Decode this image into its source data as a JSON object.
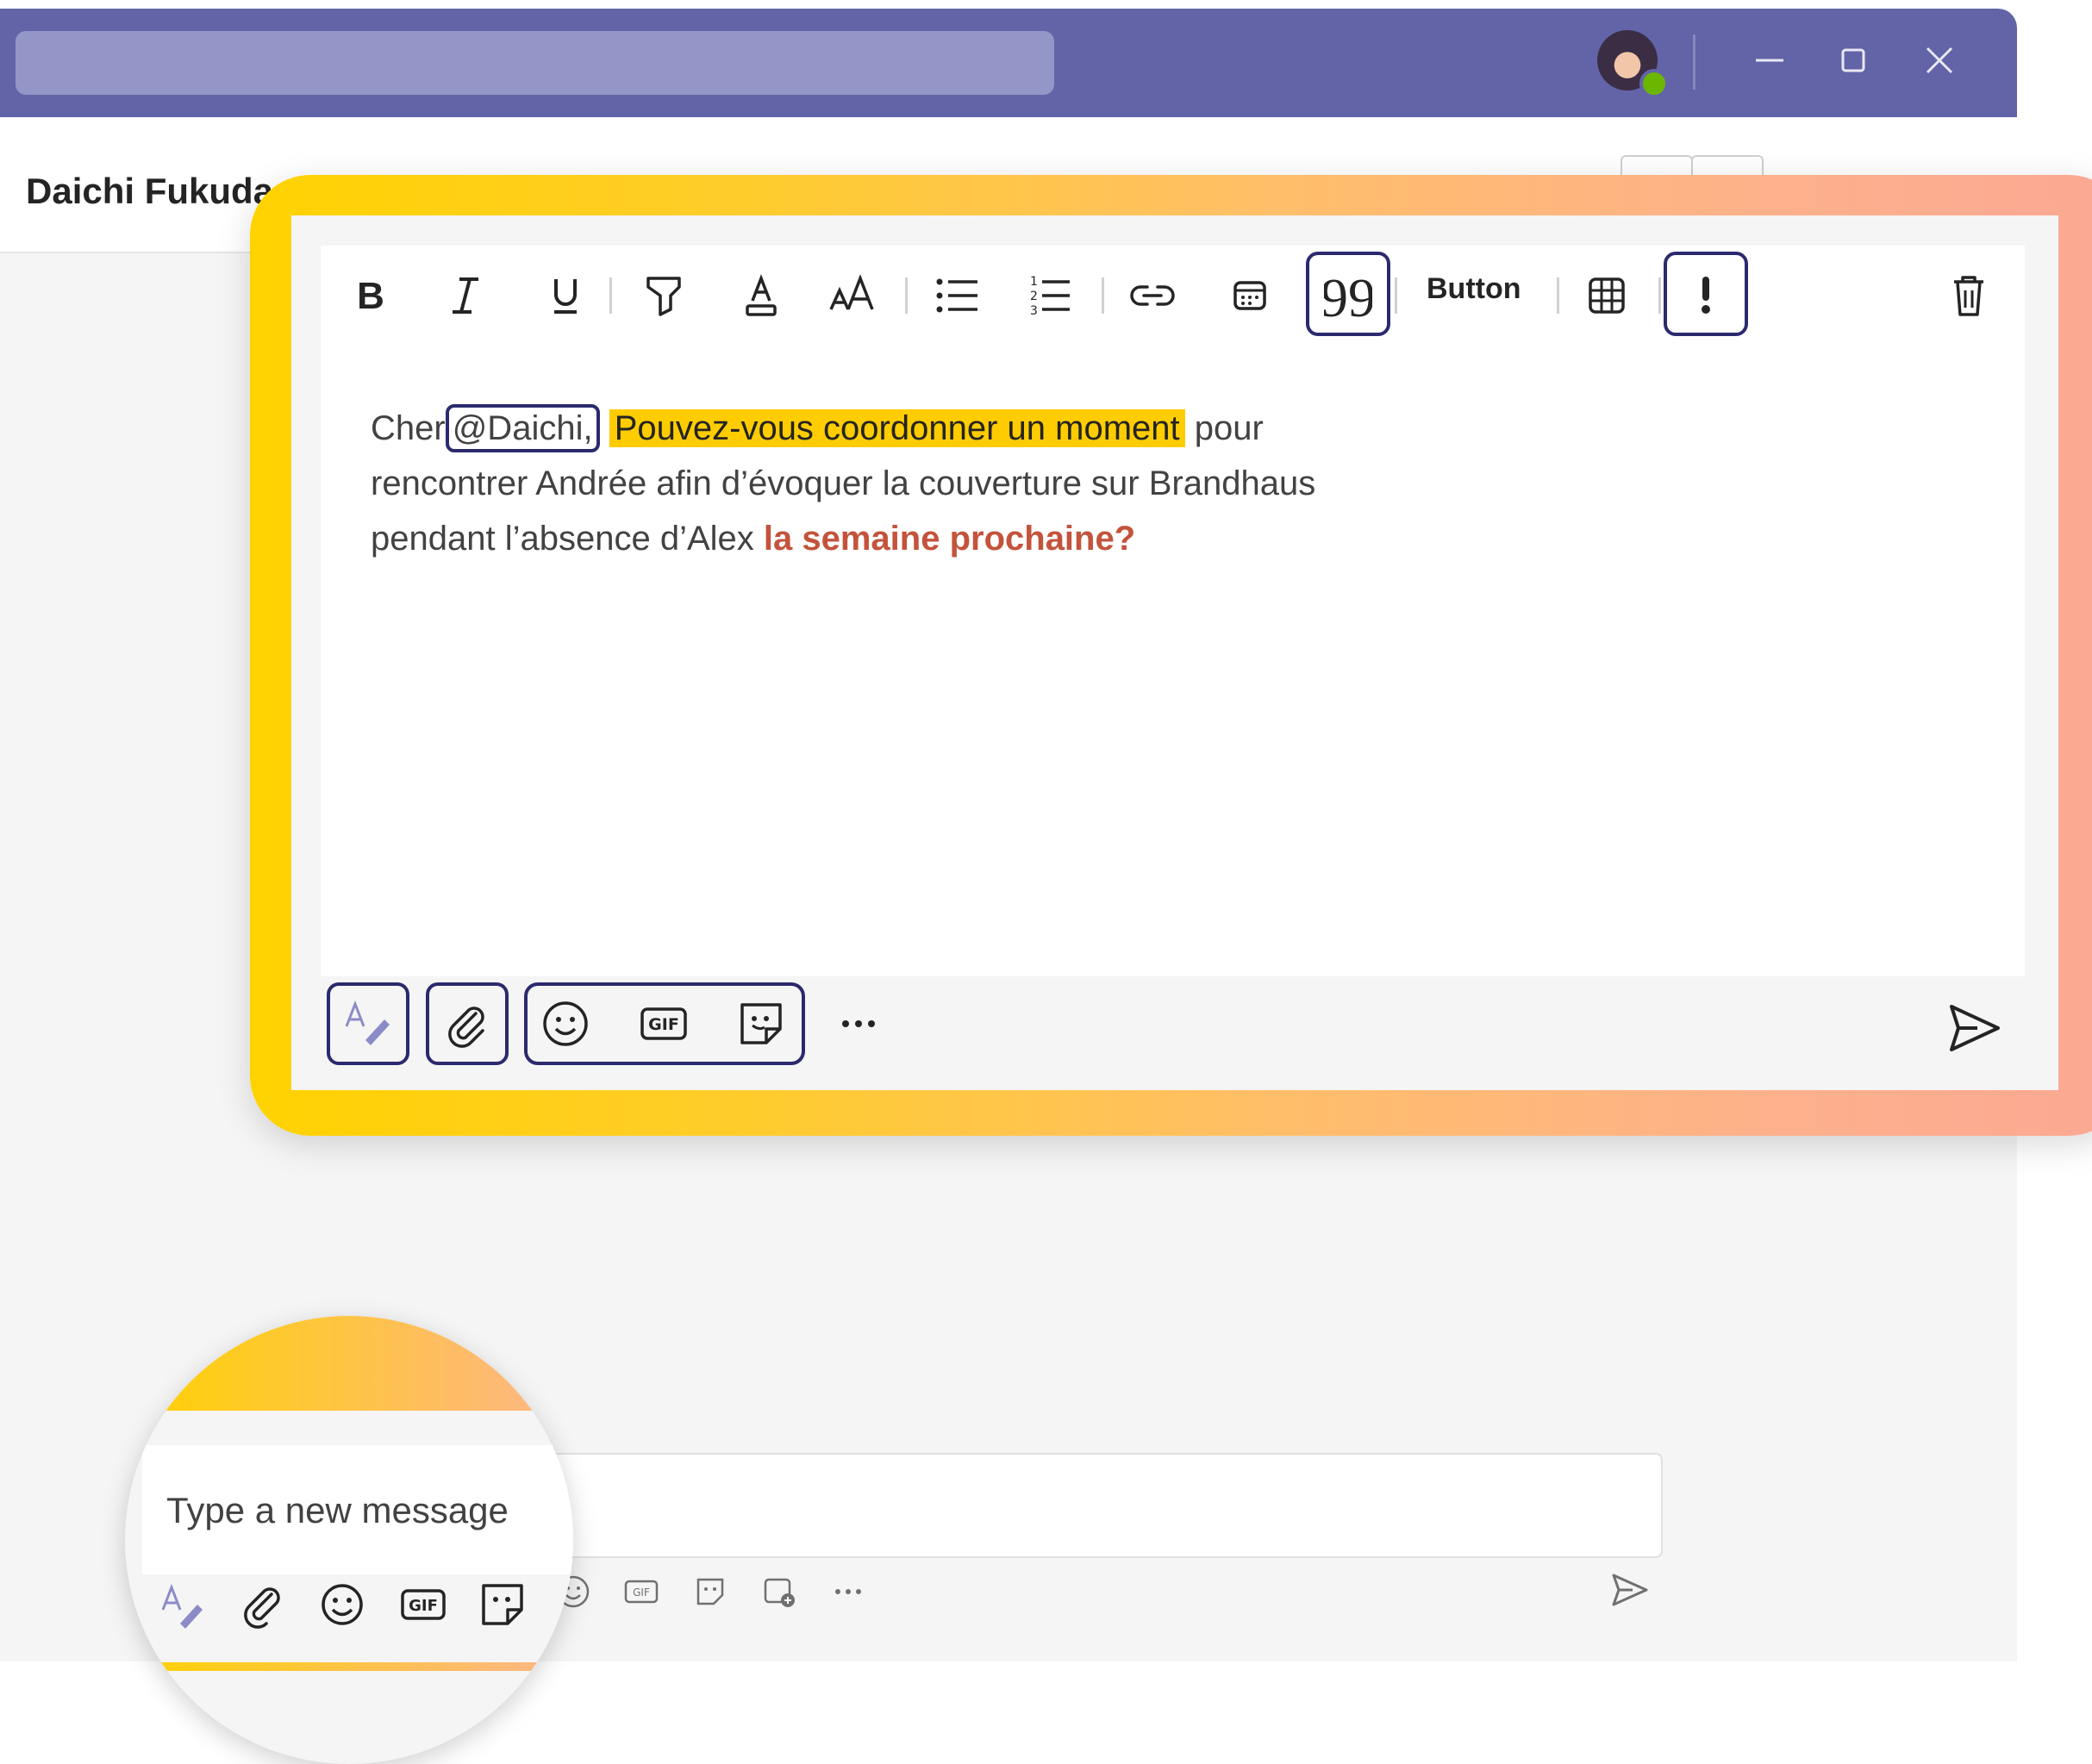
{
  "window": {
    "chat_title": "Daichi Fukuda"
  },
  "toolbar": {
    "items": [
      "bold",
      "italic",
      "underline",
      "highlight",
      "font-color",
      "font-size",
      "bulleted-list",
      "numbered-list",
      "link",
      "schedule",
      "quote",
      "button",
      "table",
      "important",
      "delete"
    ],
    "button_label": "Button"
  },
  "message": {
    "prefix": "Cher",
    "mention": "@Daichi,",
    "highlight": "Pouvez-vous coordonner un moment",
    "after_highlight": " pour",
    "line2": "rencontrer Andrée afin d’évoquer la couverture sur Brandhaus",
    "line3_plain": "pendant l’absence d’Alex ",
    "line3_red": "la semaine prochaine?"
  },
  "compose": {
    "placeholder": "Type a new message"
  },
  "colors": {
    "titlebar": "#6264a7",
    "accent_box": "#2b2a6e",
    "highlight": "#ffcc00",
    "red_text": "#c4533c",
    "presence": "#6bb700"
  }
}
